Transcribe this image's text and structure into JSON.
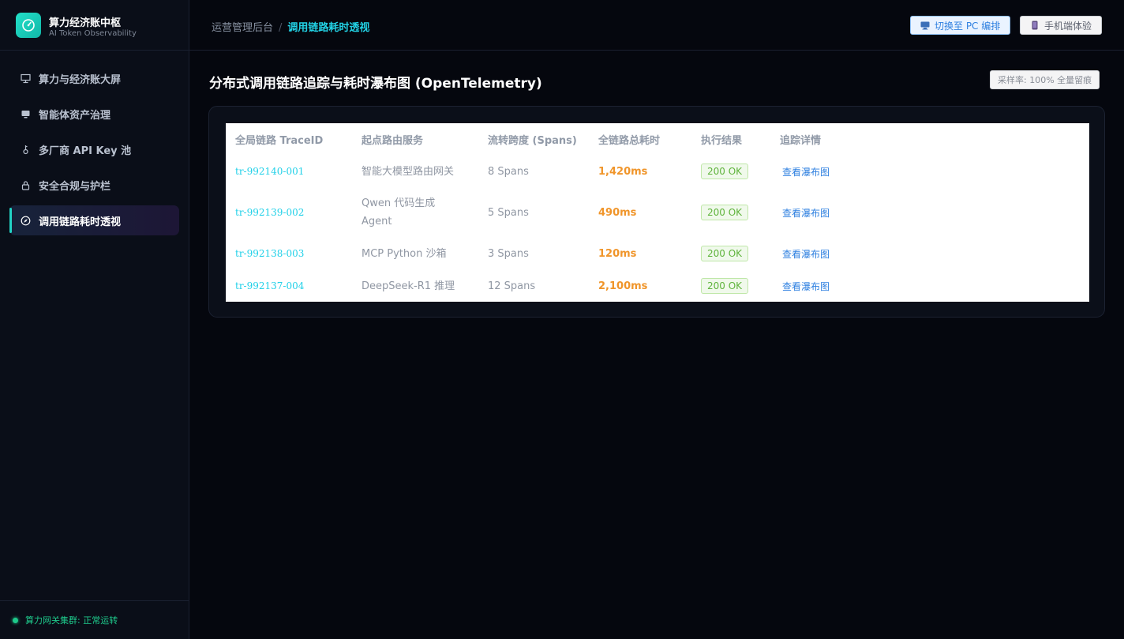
{
  "brand": {
    "title": "算力经济账中枢",
    "subtitle": "AI Token Observability",
    "logo_icon": "gauge-icon"
  },
  "sidebar": {
    "items": [
      {
        "label": "算力与经济账大屏",
        "icon": "dashboard-icon",
        "active": false
      },
      {
        "label": "智能体资产治理",
        "icon": "monitor-icon",
        "active": false
      },
      {
        "label": "多厂商 API Key 池",
        "icon": "key-icon",
        "active": false
      },
      {
        "label": "安全合规与护栏",
        "icon": "lock-icon",
        "active": false
      },
      {
        "label": "调用链路耗时透视",
        "icon": "compass-icon",
        "active": true
      }
    ],
    "footer_status": "算力网关集群: 正常运转"
  },
  "header": {
    "breadcrumb_root": "运营管理后台",
    "breadcrumb_sep": "/",
    "breadcrumb_current": "调用链路耗时透视",
    "pc_button": "切换至 PC 编排",
    "mobile_button": "手机端体验"
  },
  "main": {
    "title": "分布式调用链路追踪与耗时瀑布图 (OpenTelemetry)",
    "sample_rate_badge": "采样率: 100% 全量留痕",
    "table": {
      "columns": [
        "全局链路 TraceID",
        "起点路由服务",
        "流转跨度 (Spans)",
        "全链路总耗时",
        "执行结果",
        "追踪详情"
      ],
      "rows": [
        {
          "trace_id": "tr-992140-001",
          "service": "智能大模型路由网关",
          "spans": "8 Spans",
          "duration": "1,420ms",
          "result": "200 OK",
          "detail": "查看瀑布图"
        },
        {
          "trace_id": "tr-992139-002",
          "service": "Qwen 代码生成 Agent",
          "spans": "5 Spans",
          "duration": "490ms",
          "result": "200 OK",
          "detail": "查看瀑布图"
        },
        {
          "trace_id": "tr-992138-003",
          "service": "MCP Python 沙箱",
          "spans": "3 Spans",
          "duration": "120ms",
          "result": "200 OK",
          "detail": "查看瀑布图"
        },
        {
          "trace_id": "tr-992137-004",
          "service": "DeepSeek-R1 推理",
          "spans": "12 Spans",
          "duration": "2,100ms",
          "result": "200 OK",
          "detail": "查看瀑布图"
        }
      ]
    }
  },
  "colors": {
    "accent": "#22d3e6",
    "status_ok": "#1ec98b",
    "duration": "#f0952a",
    "link": "#2f80e0"
  }
}
